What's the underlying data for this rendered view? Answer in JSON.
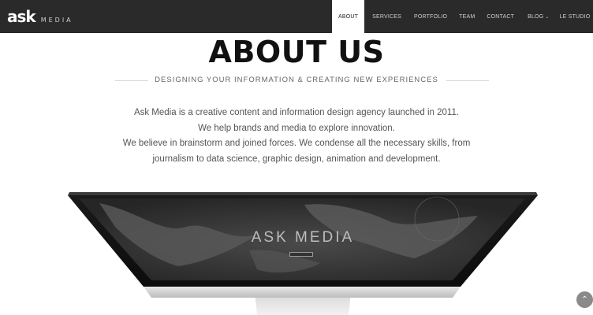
{
  "brand": {
    "mark": "ask",
    "name": "MEDIA"
  },
  "nav": {
    "items": [
      {
        "label": "ABOUT",
        "active": true
      },
      {
        "label": "SERVICES",
        "active": false
      },
      {
        "label": "PORTFOLIO",
        "active": false
      },
      {
        "label": "TEAM",
        "active": false
      },
      {
        "label": "CONTACT",
        "active": false
      },
      {
        "label": "BLOG",
        "active": false,
        "has_dropdown": true
      },
      {
        "label": "LE STUDIO",
        "active": false
      }
    ]
  },
  "hero": {
    "title": "ABOUT US",
    "subtitle": "DESIGNING YOUR INFORMATION & CREATING NEW EXPERIENCES",
    "intro": [
      "Ask Media is a creative content and information design agency launched in 2011.",
      "We help brands and media to explore innovation.",
      "We believe in brainstorm and joined forces. We condense all the necessary skills, from",
      "journalism to data science, graphic design, animation and development."
    ]
  },
  "monitor_screen": {
    "title": "ASK MEDIA"
  },
  "icons": {
    "scroll_top": "chevron-up-icon",
    "dropdown": "chevron-down-icon"
  },
  "colors": {
    "navbar": "#2a2a2a",
    "heading": "#111111",
    "text": "#555555"
  }
}
